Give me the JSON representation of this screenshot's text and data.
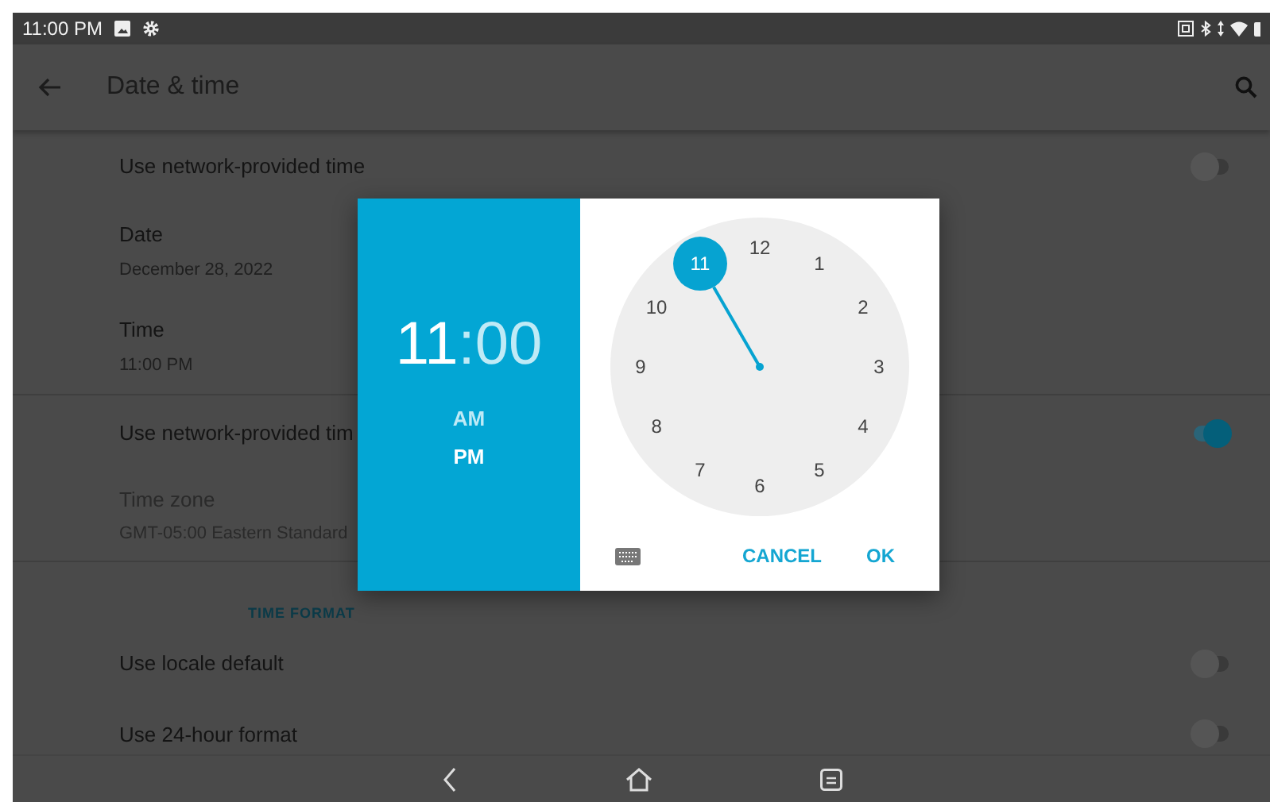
{
  "status_bar": {
    "time": "11:00 PM"
  },
  "app_bar": {
    "title": "Date & time"
  },
  "settings": [
    {
      "kind": "switch",
      "title": "Use network-provided time",
      "disabled": false,
      "on": false
    },
    {
      "kind": "detail",
      "title": "Date",
      "summary": "December 28, 2022",
      "disabled": false
    },
    {
      "kind": "detail",
      "title": "Time",
      "summary": "11:00 PM",
      "disabled": false
    },
    {
      "kind": "divider"
    },
    {
      "kind": "switch",
      "title": "Use network-provided tim",
      "disabled": false,
      "on": true
    },
    {
      "kind": "detail",
      "title": "Time zone",
      "summary": "GMT-05:00 Eastern Standard",
      "disabled": true
    },
    {
      "kind": "divider"
    },
    {
      "kind": "header",
      "title": "TIME FORMAT"
    },
    {
      "kind": "switch",
      "title": "Use locale default",
      "disabled": false,
      "on": false
    },
    {
      "kind": "switch",
      "title": "Use 24-hour format",
      "disabled": false,
      "on": false
    }
  ],
  "time_picker": {
    "hour": {
      "text": "11",
      "selected": true
    },
    "colon": ":",
    "minute": {
      "text": "00",
      "selected": false
    },
    "periods": [
      {
        "label": "AM",
        "selected": false
      },
      {
        "label": "PM",
        "selected": true
      }
    ],
    "clock_numbers": [
      {
        "label": "12",
        "selected": false
      },
      {
        "label": "1",
        "selected": false
      },
      {
        "label": "2",
        "selected": false
      },
      {
        "label": "3",
        "selected": false
      },
      {
        "label": "4",
        "selected": false
      },
      {
        "label": "5",
        "selected": false
      },
      {
        "label": "6",
        "selected": false
      },
      {
        "label": "7",
        "selected": false
      },
      {
        "label": "8",
        "selected": false
      },
      {
        "label": "9",
        "selected": false
      },
      {
        "label": "10",
        "selected": false
      },
      {
        "label": "11",
        "selected": true
      }
    ],
    "buttons": [
      "CANCEL",
      "OK"
    ]
  }
}
